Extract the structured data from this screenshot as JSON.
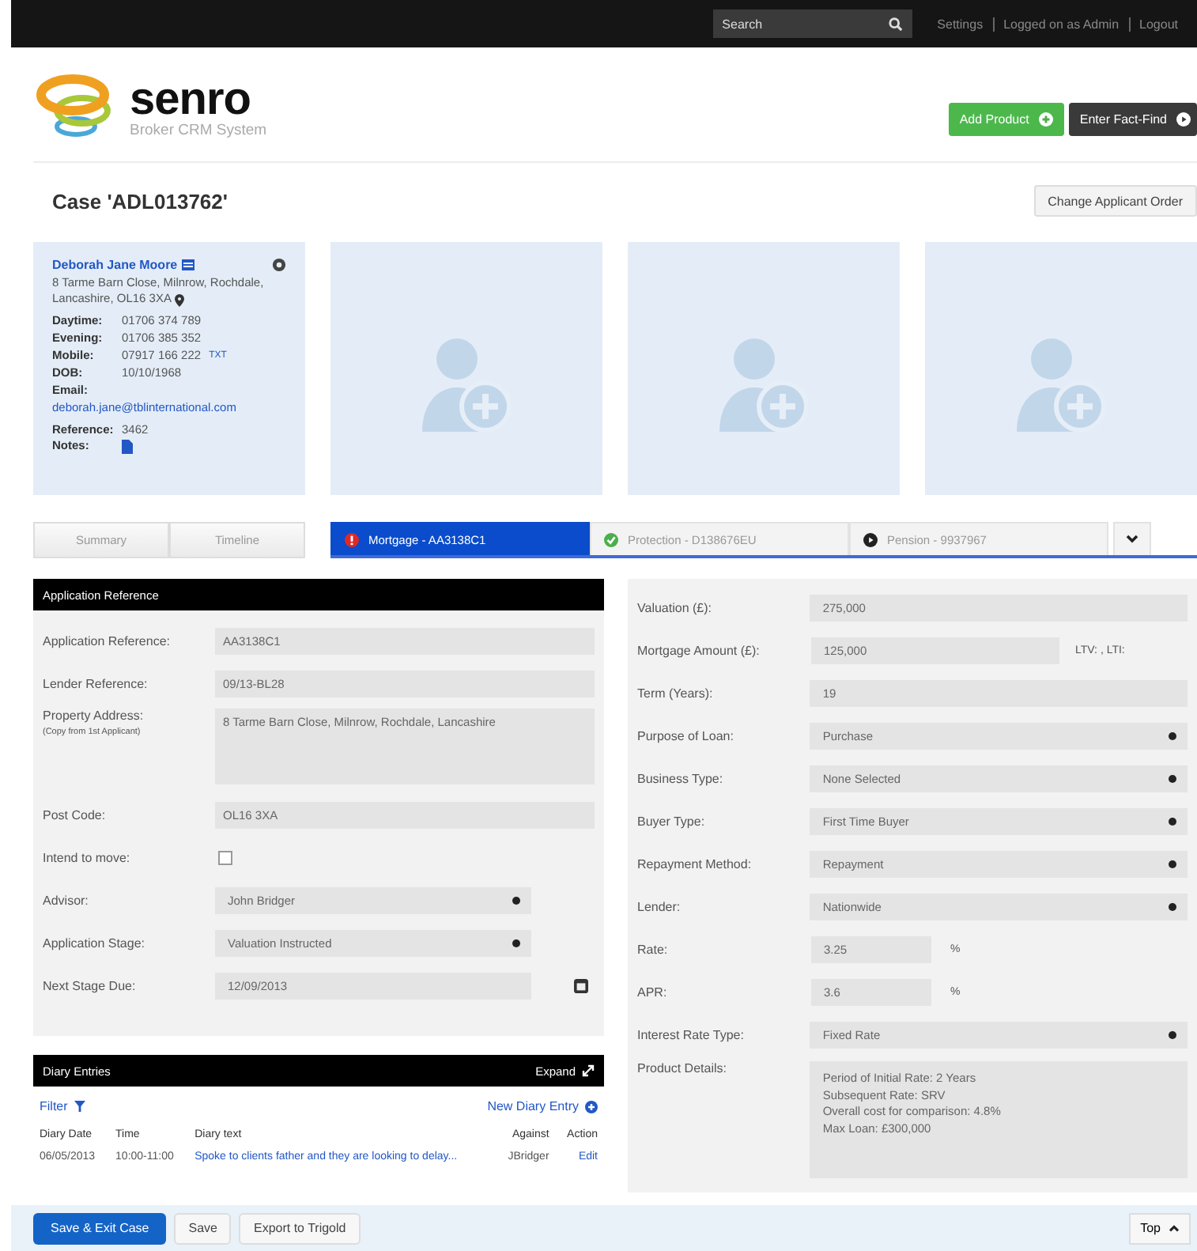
{
  "top_bar": {
    "search_placeholder": "Search",
    "links": [
      "Settings",
      "Logged on as Admin",
      "Logout"
    ]
  },
  "logo": {
    "name": "senro",
    "tagline": "Broker CRM System"
  },
  "header_buttons": [
    {
      "label": "Add Product",
      "kind": "add"
    },
    {
      "label": "Enter Fact-Find",
      "kind": "go"
    }
  ],
  "case_title": "Case 'ADL013762'",
  "change_order_button": "Change Applicant Order",
  "applicant_slots": [
    {
      "kind": "applicant",
      "name": "Deborah Jane Moore",
      "address_lines": [
        "8 Tarme Barn Close, Milnrow, Rochdale,",
        "Lancashire, OL16 3XA"
      ],
      "details": [
        {
          "label": "Daytime:",
          "value": "01706 374 789"
        },
        {
          "label": "Evening:",
          "value": "01706 385 352"
        },
        {
          "label": "Mobile:",
          "value": "07917 166 222",
          "link": "TXT"
        },
        {
          "label": "DOB:",
          "value": "10/10/1968"
        },
        {
          "label": "Email:"
        }
      ],
      "email": "deborah.jane@tblinternational.com",
      "reference_label": "Reference:",
      "reference": "3462",
      "notes_label": "Notes:"
    },
    {
      "kind": "empty"
    },
    {
      "kind": "empty"
    },
    {
      "kind": "empty"
    }
  ],
  "view_tabs": [
    {
      "label": "Summary",
      "selected": false
    },
    {
      "label": "Timeline",
      "selected": false
    }
  ],
  "product_tabs": [
    {
      "label": "Mortgage - AA3138C1",
      "kind": "alert",
      "selected": true
    },
    {
      "label": "Protection - D138676EU",
      "kind": "ok",
      "selected": false
    },
    {
      "label": "Pension - 9937967",
      "kind": "pending",
      "selected": false
    }
  ],
  "application_panel": {
    "title": "Application Reference",
    "fields": [
      {
        "kind": "text",
        "label": "Application Reference:",
        "value": "AA3138C1"
      },
      {
        "kind": "text",
        "label": "Lender Reference:",
        "value": "09/13-BL28"
      },
      {
        "kind": "textarea",
        "label": "Property Address:",
        "sublabel": "(Copy from 1st Applicant)",
        "value": "8 Tarme Barn Close, Milnrow, Rochdale, Lancashire"
      },
      {
        "kind": "text",
        "label": "Post Code:",
        "value": "OL16 3XA"
      },
      {
        "kind": "checkbox",
        "label": "Intend to move:",
        "checked": false
      },
      {
        "kind": "select",
        "label": "Advisor:",
        "value": "John Bridger"
      },
      {
        "kind": "select",
        "label": "Application Stage:",
        "value": "Valuation Instructed"
      },
      {
        "kind": "date",
        "label": "Next Stage Due:",
        "value": "12/09/2013"
      }
    ]
  },
  "product_panel": {
    "fields": [
      {
        "kind": "text",
        "label": "Valuation (£):",
        "value": "275,000"
      },
      {
        "kind": "medium",
        "label": "Mortgage Amount (£):",
        "value": "125,000",
        "suffix": "LTV: , LTI:"
      },
      {
        "kind": "text",
        "label": "Term (Years):",
        "value": "19"
      },
      {
        "kind": "select",
        "label": "Purpose of Loan:",
        "value": "Purchase"
      },
      {
        "kind": "select",
        "label": "Business Type:",
        "value": "None Selected"
      },
      {
        "kind": "select",
        "label": "Buyer Type:",
        "value": "First Time Buyer"
      },
      {
        "kind": "select",
        "label": "Repayment Method:",
        "value": "Repayment"
      },
      {
        "kind": "select",
        "label": "Lender:",
        "value": "Nationwide"
      },
      {
        "kind": "short",
        "label": "Rate:",
        "value": "3.25",
        "suffix": "%"
      },
      {
        "kind": "short",
        "label": "APR:",
        "value": "3.6",
        "suffix": "%"
      },
      {
        "kind": "select",
        "label": "Interest Rate Type:",
        "value": "Fixed Rate"
      },
      {
        "kind": "textarea",
        "label": "Product Details:",
        "lines": [
          "Period of Initial Rate: 2 Years",
          "Subsequent Rate: SRV",
          "Overall cost for comparison: 4.8%",
          "Max Loan: £300,000"
        ]
      }
    ]
  },
  "diary": {
    "title": "Diary Entries",
    "expand": "Expand",
    "filter": "Filter",
    "new_entry": "New Diary Entry",
    "columns": [
      "Diary Date",
      "Time",
      "Diary text",
      "Against",
      "Action"
    ],
    "rows": [
      {
        "date": "06/05/2013",
        "time": "10:00-11:00",
        "text": "Spoke to clients father and they are looking to delay...",
        "against": "JBridger",
        "action": "Edit"
      }
    ]
  },
  "footer": {
    "buttons": [
      {
        "label": "Save & Exit Case",
        "kind": "primary"
      },
      {
        "label": "Save",
        "kind": "plain"
      },
      {
        "label": "Export to Trigold",
        "kind": "plain"
      }
    ],
    "top": "Top"
  }
}
